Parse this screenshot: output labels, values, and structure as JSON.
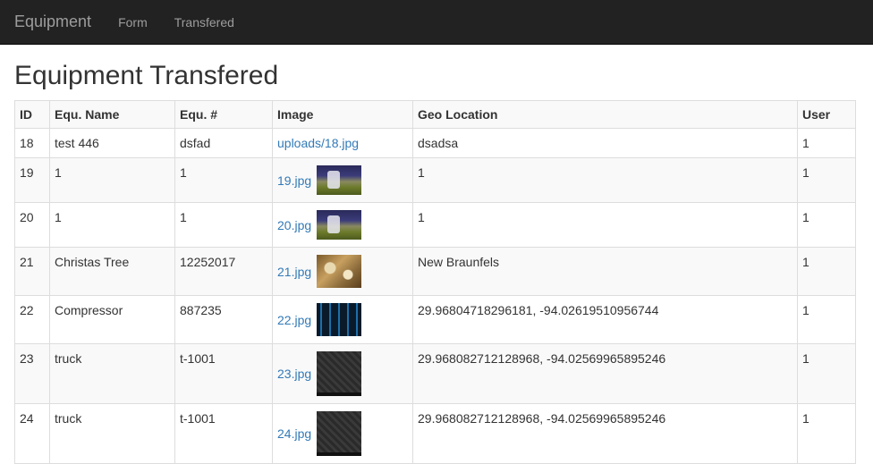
{
  "navbar": {
    "brand": "Equipment",
    "links": [
      "Form",
      "Transfered"
    ]
  },
  "page": {
    "title": "Equipment Transfered"
  },
  "table": {
    "headers": [
      "ID",
      "Equ. Name",
      "Equ. #",
      "Image",
      "Geo Location",
      "User"
    ],
    "rows": [
      {
        "id": "18",
        "name": "test 446",
        "number": "dsfad",
        "image_link": "uploads/18.jpg",
        "thumb": "",
        "geo": "dsadsa",
        "user": "1"
      },
      {
        "id": "19",
        "name": "1",
        "number": "1",
        "image_link": "19.jpg",
        "thumb": "football",
        "geo": "1",
        "user": "1"
      },
      {
        "id": "20",
        "name": "1",
        "number": "1",
        "image_link": "20.jpg",
        "thumb": "football",
        "geo": "1",
        "user": "1"
      },
      {
        "id": "21",
        "name": "Christas Tree",
        "number": "12252017",
        "image_link": "21.jpg",
        "thumb": "tree",
        "geo": "New Braunfels",
        "user": "1"
      },
      {
        "id": "22",
        "name": "Compressor",
        "number": "887235",
        "image_link": "22.jpg",
        "thumb": "compressor",
        "geo": "29.96804718296181, -94.02619510956744",
        "user": "1"
      },
      {
        "id": "23",
        "name": "truck",
        "number": "t-1001",
        "image_link": "23.jpg",
        "thumb": "truck",
        "geo": "29.968082712128968, -94.02569965895246",
        "user": "1"
      },
      {
        "id": "24",
        "name": "truck",
        "number": "t-1001",
        "image_link": "24.jpg",
        "thumb": "truck",
        "geo": "29.968082712128968, -94.02569965895246",
        "user": "1"
      }
    ]
  }
}
